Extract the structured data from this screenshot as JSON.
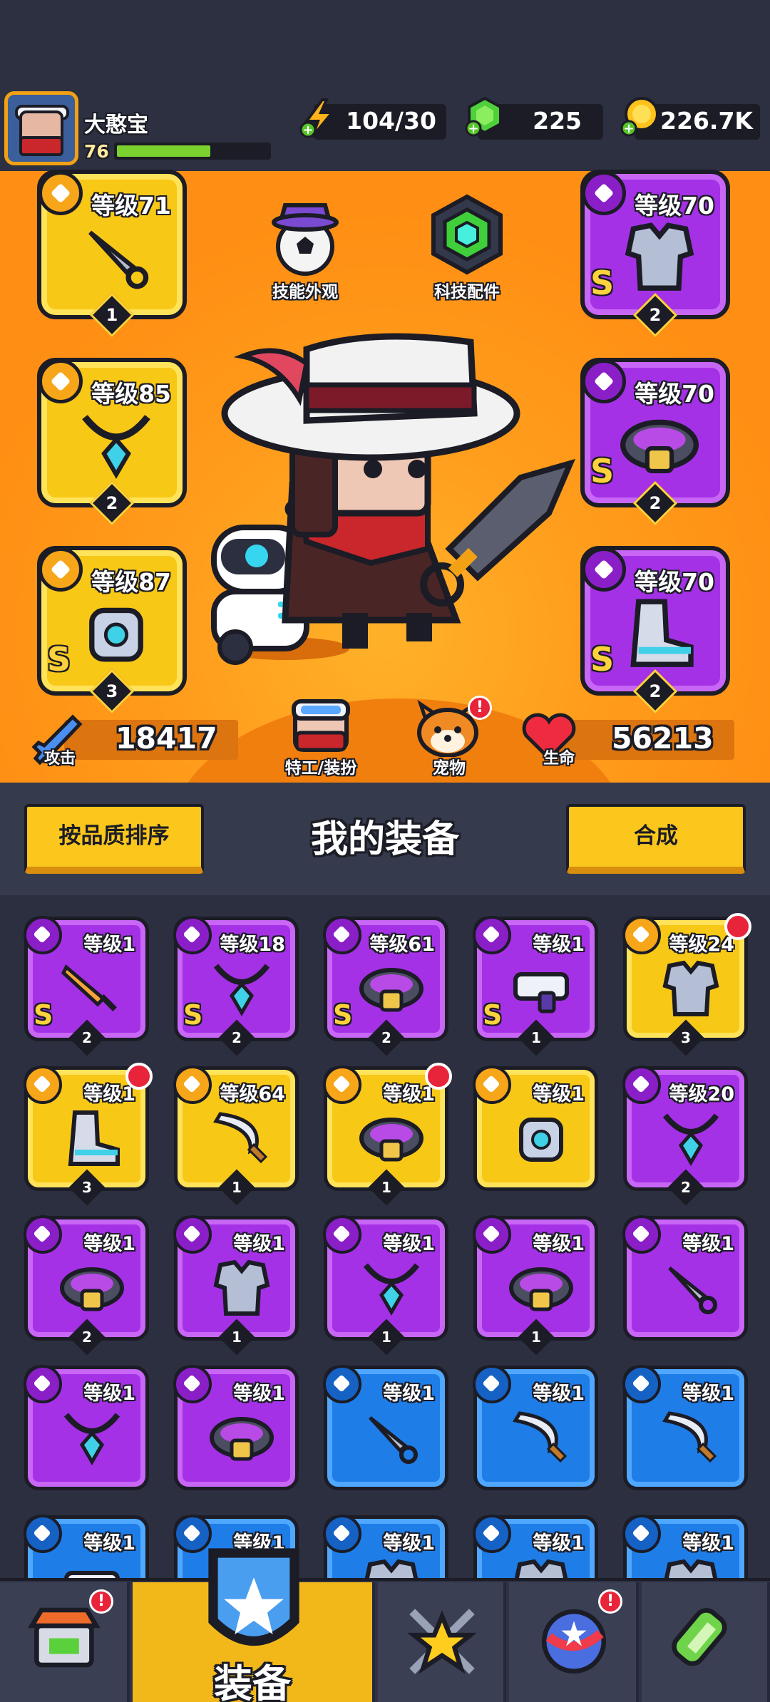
{
  "player": {
    "name": "大憨宝",
    "level": "76",
    "xp_fraction": 0.62
  },
  "resources": {
    "energy": "104/30",
    "gems": "225",
    "gold": "226.7K"
  },
  "hero": {
    "skin_label": "技能外观",
    "tech_label": "科技配件",
    "agent_label": "特工/装扮",
    "pet_label": "宠物",
    "attack_label": "攻击",
    "attack_value": "18417",
    "hp_label": "生命",
    "hp_value": "56213",
    "slots": [
      {
        "level": "等级71",
        "count": "1",
        "rarity": "yellow",
        "s": "",
        "icon": "kunai-icon"
      },
      {
        "level": "等级85",
        "count": "2",
        "rarity": "yellow",
        "s": "",
        "icon": "necklace-icon"
      },
      {
        "level": "等级87",
        "count": "3",
        "rarity": "yellow",
        "s": "S",
        "icon": "gauntlet-icon"
      },
      {
        "level": "等级70",
        "count": "2",
        "rarity": "purple",
        "s": "S",
        "icon": "armor-icon"
      },
      {
        "level": "等级70",
        "count": "2",
        "rarity": "purple",
        "s": "S",
        "icon": "belt-icon"
      },
      {
        "level": "等级70",
        "count": "2",
        "rarity": "purple",
        "s": "S",
        "icon": "boot-icon"
      }
    ]
  },
  "equipment": {
    "sort_label": "按品质排序",
    "title": "我的装备",
    "merge_label": "合成",
    "items": [
      {
        "level": "等级1",
        "count": "2",
        "rarity": "purple",
        "s": "S",
        "new": false,
        "icon": "sword-icon"
      },
      {
        "level": "等级18",
        "count": "2",
        "rarity": "purple",
        "s": "S",
        "new": false,
        "icon": "necklace-icon"
      },
      {
        "level": "等级61",
        "count": "2",
        "rarity": "purple",
        "s": "S",
        "new": false,
        "icon": "belt-icon"
      },
      {
        "level": "等级1",
        "count": "1",
        "rarity": "purple",
        "s": "S",
        "new": false,
        "icon": "blaster-icon"
      },
      {
        "level": "等级24",
        "count": "3",
        "rarity": "yellow",
        "s": "",
        "new": true,
        "icon": "armor-icon"
      },
      {
        "level": "等级1",
        "count": "3",
        "rarity": "yellow",
        "s": "",
        "new": true,
        "icon": "boot-icon"
      },
      {
        "level": "等级64",
        "count": "1",
        "rarity": "yellow",
        "s": "",
        "new": false,
        "icon": "scimitar-icon"
      },
      {
        "level": "等级1",
        "count": "1",
        "rarity": "yellow",
        "s": "",
        "new": true,
        "icon": "belt-icon"
      },
      {
        "level": "等级1",
        "count": "",
        "rarity": "yellow",
        "s": "",
        "new": false,
        "icon": "gauntlet-icon"
      },
      {
        "level": "等级20",
        "count": "2",
        "rarity": "purple",
        "s": "",
        "new": false,
        "icon": "necklace-icon"
      },
      {
        "level": "等级1",
        "count": "2",
        "rarity": "purple",
        "s": "",
        "new": false,
        "icon": "belt-icon"
      },
      {
        "level": "等级1",
        "count": "1",
        "rarity": "purple",
        "s": "",
        "new": false,
        "icon": "armor-icon"
      },
      {
        "level": "等级1",
        "count": "1",
        "rarity": "purple",
        "s": "",
        "new": false,
        "icon": "necklace-icon"
      },
      {
        "level": "等级1",
        "count": "1",
        "rarity": "purple",
        "s": "",
        "new": false,
        "icon": "belt-icon"
      },
      {
        "level": "等级1",
        "count": "",
        "rarity": "purple",
        "s": "",
        "new": false,
        "icon": "kunai-icon"
      },
      {
        "level": "等级1",
        "count": "",
        "rarity": "purple",
        "s": "",
        "new": false,
        "icon": "necklace-icon"
      },
      {
        "level": "等级1",
        "count": "",
        "rarity": "purple",
        "s": "",
        "new": false,
        "icon": "belt-icon"
      },
      {
        "level": "等级1",
        "count": "",
        "rarity": "blue",
        "s": "",
        "new": false,
        "icon": "kunai-icon"
      },
      {
        "level": "等级1",
        "count": "",
        "rarity": "blue",
        "s": "",
        "new": false,
        "icon": "scimitar-icon"
      },
      {
        "level": "等级1",
        "count": "",
        "rarity": "blue",
        "s": "",
        "new": false,
        "icon": "scimitar-icon"
      },
      {
        "level": "等级1",
        "count": "",
        "rarity": "blue",
        "s": "",
        "new": false,
        "icon": "blaster-icon"
      },
      {
        "level": "等级1",
        "count": "",
        "rarity": "blue",
        "s": "",
        "new": false,
        "icon": "necklace-icon"
      },
      {
        "level": "等级1",
        "count": "",
        "rarity": "blue",
        "s": "",
        "new": false,
        "icon": "armor-icon"
      },
      {
        "level": "等级1",
        "count": "",
        "rarity": "blue",
        "s": "",
        "new": false,
        "icon": "armor-icon"
      },
      {
        "level": "等级1",
        "count": "",
        "rarity": "blue",
        "s": "",
        "new": false,
        "icon": "armor-icon"
      }
    ]
  },
  "nav": {
    "tabs": [
      {
        "icon": "shop-icon",
        "label": "",
        "alert": "!"
      },
      {
        "icon": "equipment-icon",
        "label": "装备",
        "alert": ""
      },
      {
        "icon": "battle-icon",
        "label": "",
        "alert": ""
      },
      {
        "icon": "talent-icon",
        "label": "",
        "alert": "!"
      },
      {
        "icon": "evolution-icon",
        "label": "",
        "alert": ""
      }
    ]
  },
  "colors": {
    "yellow": "#f8c816",
    "purple": "#a531e6",
    "blue": "#1f7de8",
    "orange": "#ff9d1c"
  }
}
